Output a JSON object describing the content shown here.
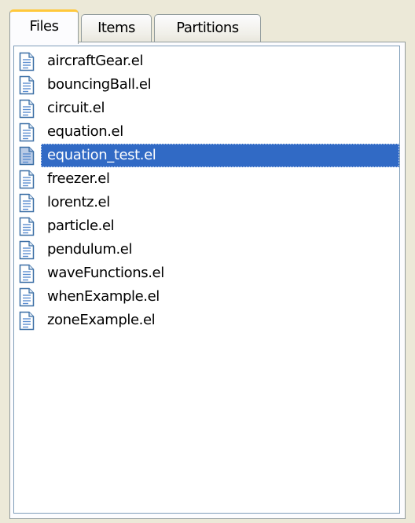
{
  "tabs": {
    "files": "Files",
    "items": "Items",
    "partitions": "Partitions"
  },
  "active_tab": "Files",
  "file_list": {
    "selected": "equation_test.el",
    "items": [
      "aircraftGear.el",
      "bouncingBall.el",
      "circuit.el",
      "equation.el",
      "equation_test.el",
      "freezer.el",
      "lorentz.el",
      "particle.el",
      "pendulum.el",
      "waveFunctions.el",
      "whenExample.el",
      "zoneExample.el"
    ]
  },
  "icons": {
    "file": "document-icon"
  },
  "colors": {
    "window_background": "#ece9d8",
    "selection": "#316ac5",
    "active_tab_highlight": "#ffc83c",
    "icon_blue": "#3a6ea5"
  }
}
